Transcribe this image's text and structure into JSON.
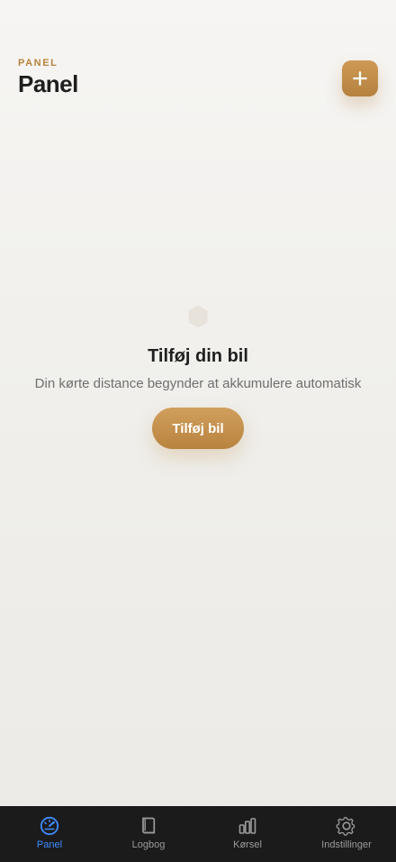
{
  "header": {
    "eyebrow": "PANEL",
    "title": "Panel",
    "add_button_icon": "plus-icon"
  },
  "empty_state": {
    "icon": "hexagon-icon",
    "title": "Tilføj din bil",
    "subtitle": "Din kørte distance begynder at akkumulere automatisk",
    "cta_label": "Tilføj bil"
  },
  "tabs": [
    {
      "label": "Panel",
      "icon": "speedometer-icon",
      "active": true
    },
    {
      "label": "Logbog",
      "icon": "book-icon",
      "active": false
    },
    {
      "label": "Kørsel",
      "icon": "bar-chart-icon",
      "active": false
    },
    {
      "label": "Indstillinger",
      "icon": "gear-icon",
      "active": false
    }
  ],
  "colors": {
    "accent": "#C38D48",
    "tab_active": "#3F8CFF",
    "tab_inactive": "#9B9B9B",
    "tabbar_bg": "#1B1B1C"
  }
}
